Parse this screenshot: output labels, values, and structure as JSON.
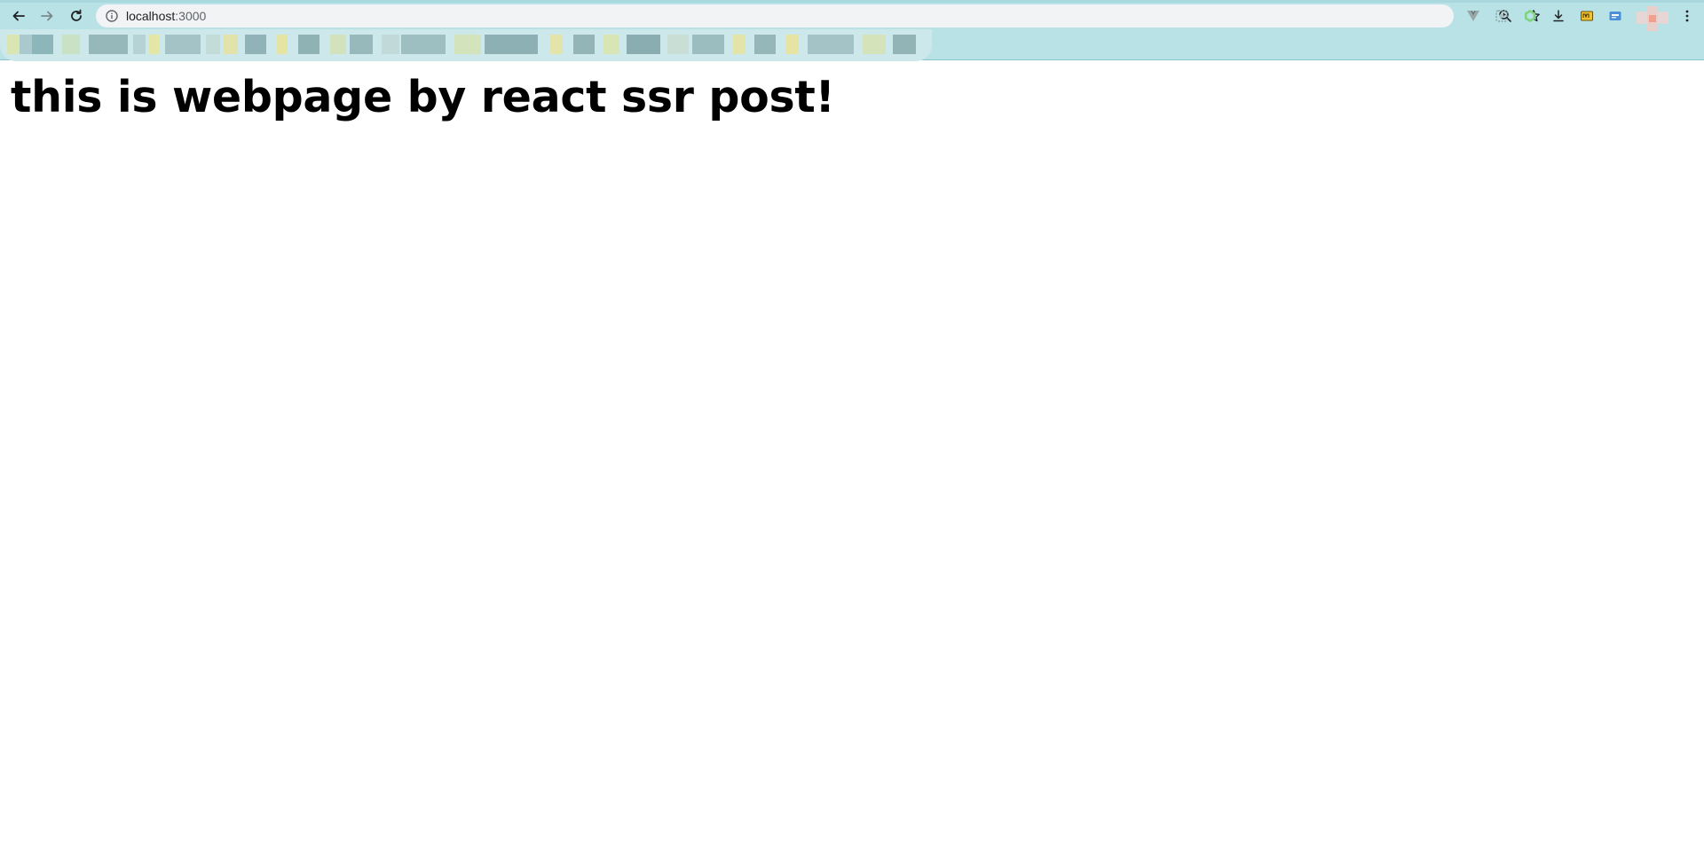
{
  "browser": {
    "url_host": "localhost",
    "url_port": ":3000",
    "colors": {
      "chrome_bg": "#b8e2e6",
      "omnibox_bg": "#f1f3f4"
    },
    "icons": {
      "back": "arrow-left-icon",
      "forward": "arrow-right-icon",
      "reload": "reload-icon",
      "info": "info-icon",
      "zoom": "zoom-icon",
      "bookmark": "star-icon",
      "extensions": [
        "vue-devtools-icon",
        "screenshot-icon",
        "node-icon",
        "download-icon",
        "folder-icon",
        "card-icon",
        "profile-avatar",
        "menu-kebab-icon"
      ]
    }
  },
  "page": {
    "heading": "this is webpage by react ssr post!"
  }
}
